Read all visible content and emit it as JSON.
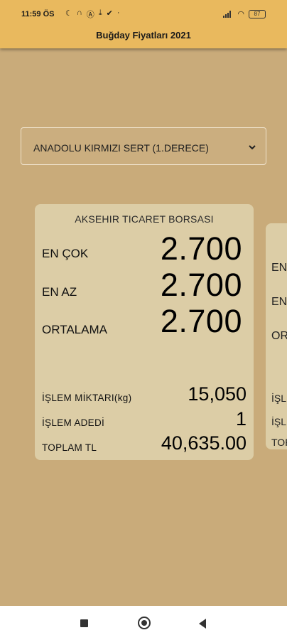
{
  "status_bar": {
    "time": "11:59 ÖS",
    "left_icons": [
      "moon-icon",
      "headphones-icon",
      "a-badge-icon",
      "download-icon",
      "check-badge-icon",
      "dot-icon"
    ],
    "battery": "87"
  },
  "app_bar": {
    "title": "Buğday Fiyatları 2021"
  },
  "dropdown": {
    "selected": "ANADOLU KIRMIZI SERT (1.DERECE)"
  },
  "card": {
    "title": "AKSEHIR TICARET BORSASI",
    "max_label": "EN ÇOK",
    "max_value": "2.700",
    "min_label": "EN AZ",
    "min_value": "2.700",
    "avg_label": "ORTALAMA",
    "avg_value": "2.700",
    "qty_label": "İŞLEM MİKTARI(kg)",
    "qty_value": "15,050",
    "count_label": "İŞLEM ADEDİ",
    "count_value": "1",
    "total_label": "TOPLAM TL",
    "total_value": "40,635.00"
  },
  "card_next_partial": {
    "l1": "EN",
    "l2": "EN",
    "l3": "OR",
    "l4": "İŞL",
    "l5": "İŞL",
    "l6": "TOP"
  },
  "colors": {
    "app_bar": "#e9b95e",
    "background": "#c9ab7a",
    "card": "#dccda6"
  }
}
